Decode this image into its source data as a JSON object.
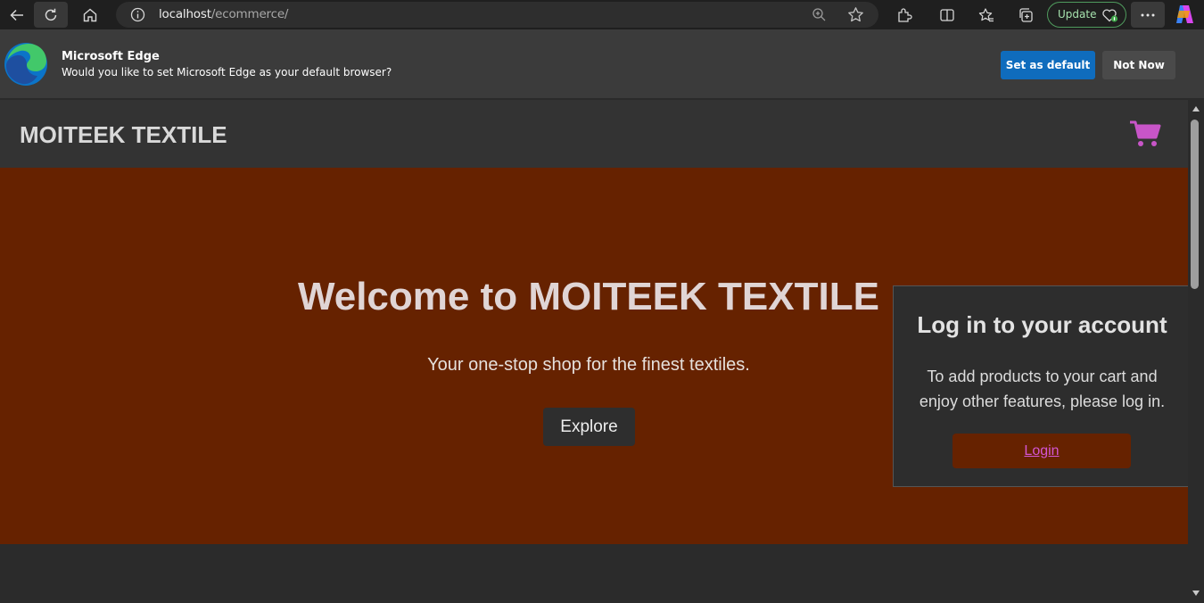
{
  "browser": {
    "url_host": "localhost",
    "url_path": "/ecommerce/",
    "update_label": "Update",
    "icons": [
      "back-icon",
      "refresh-icon",
      "home-icon",
      "info-icon",
      "zoom-icon",
      "favorite-star-icon",
      "extensions-icon",
      "split-screen-icon",
      "favorites-icon",
      "collections-icon",
      "browser-essentials-icon",
      "more-icon",
      "copilot-icon"
    ]
  },
  "banner": {
    "title": "Microsoft Edge",
    "message": "Would you like to set Microsoft Edge as your default browser?",
    "set_default_label": "Set as default",
    "not_now_label": "Not Now"
  },
  "site": {
    "brand": "MOITEEK TEXTILE",
    "hero": {
      "title": "Welcome to MOITEEK TEXTILE",
      "subtitle": "Your one-stop shop for the finest textiles.",
      "cta_label": "Explore"
    },
    "login_card": {
      "title": "Log in to your account",
      "message": "To add products to your cart and enjoy other features, please log in.",
      "login_label": "Login"
    }
  },
  "colors": {
    "hero_bg": "#662200",
    "cart_icon": "#c855c8",
    "login_link": "#d455d4",
    "banner_primary": "#0f6cbd"
  }
}
